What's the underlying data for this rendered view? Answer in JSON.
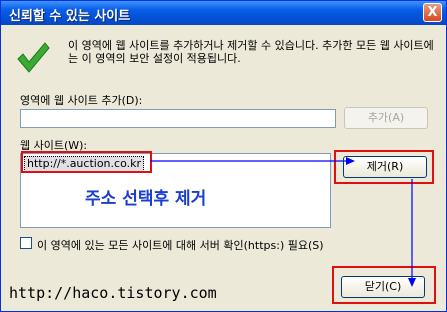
{
  "window": {
    "title": "신뢰할 수 있는 사이트",
    "close_label": "X"
  },
  "message": "이 영역에 웹 사이트를 추가하거나 제거할 수 있습니다. 추가한 모든 웹 사이트에는 이 영역의 보안 설정이 적용됩니다.",
  "add_section": {
    "label": "영역에 웹 사이트 추가(D):",
    "input_value": "",
    "add_button": "추가(A)"
  },
  "websites": {
    "label": "웹 사이트(W):",
    "items": [
      "http://*.auction.co.kr"
    ],
    "remove_button": "제거(R)"
  },
  "annotation": {
    "text": "주소 선택후 제거",
    "watermark": "http://haco.tistory.com"
  },
  "https_option": {
    "label": "이 영역에 있는 모든 사이트에 대해 서버 확인(https:) 필요(S)",
    "checked": false
  },
  "close_button": "닫기(C)",
  "colors": {
    "titlebar": "#0a5fe8",
    "annotation_blue": "#1a3ecf",
    "highlight_red": "#e01010",
    "arrow_blue": "#0000ff",
    "check_green": "#3aaa35"
  },
  "icons": {
    "status": "green-checkmark-icon",
    "close": "close-icon"
  }
}
